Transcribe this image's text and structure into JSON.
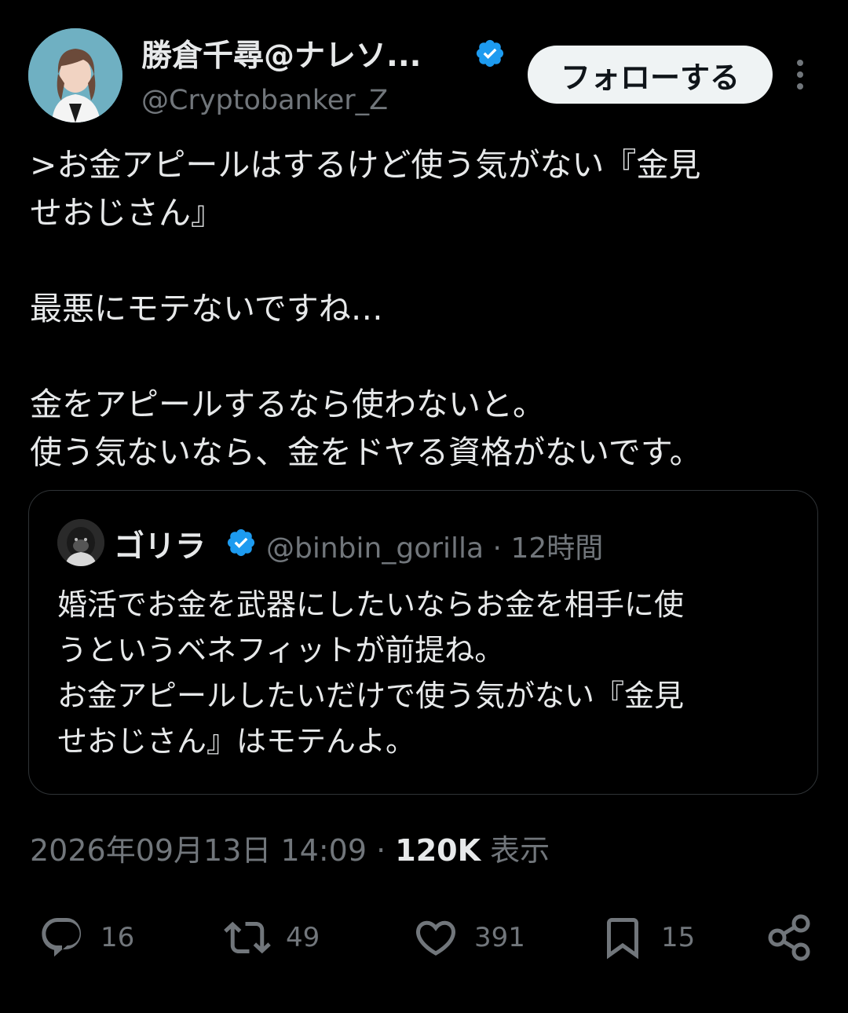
{
  "author": {
    "display_name": "勝倉千尋@ナレソ...",
    "handle": "@Cryptobanker_Z",
    "verified_icon": "verified-badge-icon",
    "follow_label": "フォローする",
    "more_icon": "more-dots-icon"
  },
  "tweet": {
    "text": ">お金アピールはするけど使う気がない『金見\nせおじさん』\n\n最悪にモテないですね…\n\n金をアピールするなら使わないと。\n使う気ないなら、金をドヤる資格がないです。"
  },
  "quote": {
    "display_name": "ゴリラ",
    "handle": "@binbin_gorilla",
    "separator": "·",
    "time": "12時間",
    "text": "婚活でお金を武器にしたいならお金を相手に使\nうというベネフィットが前提ね。\nお金アピールしたいだけで使う気がない『金見\nせおじさん』はモテんよ。"
  },
  "meta": {
    "timestamp": "2026年09月13日 14:09",
    "dot": "·",
    "views_count": "120K",
    "views_label": "表示"
  },
  "actions": {
    "replies": "16",
    "reposts": "49",
    "likes": "391",
    "bookmarks": "15"
  },
  "colors": {
    "background": "#000000",
    "text": "#e7e9ea",
    "secondary": "#71767b",
    "verified": "#1d9bf0",
    "border": "#2f3336"
  }
}
